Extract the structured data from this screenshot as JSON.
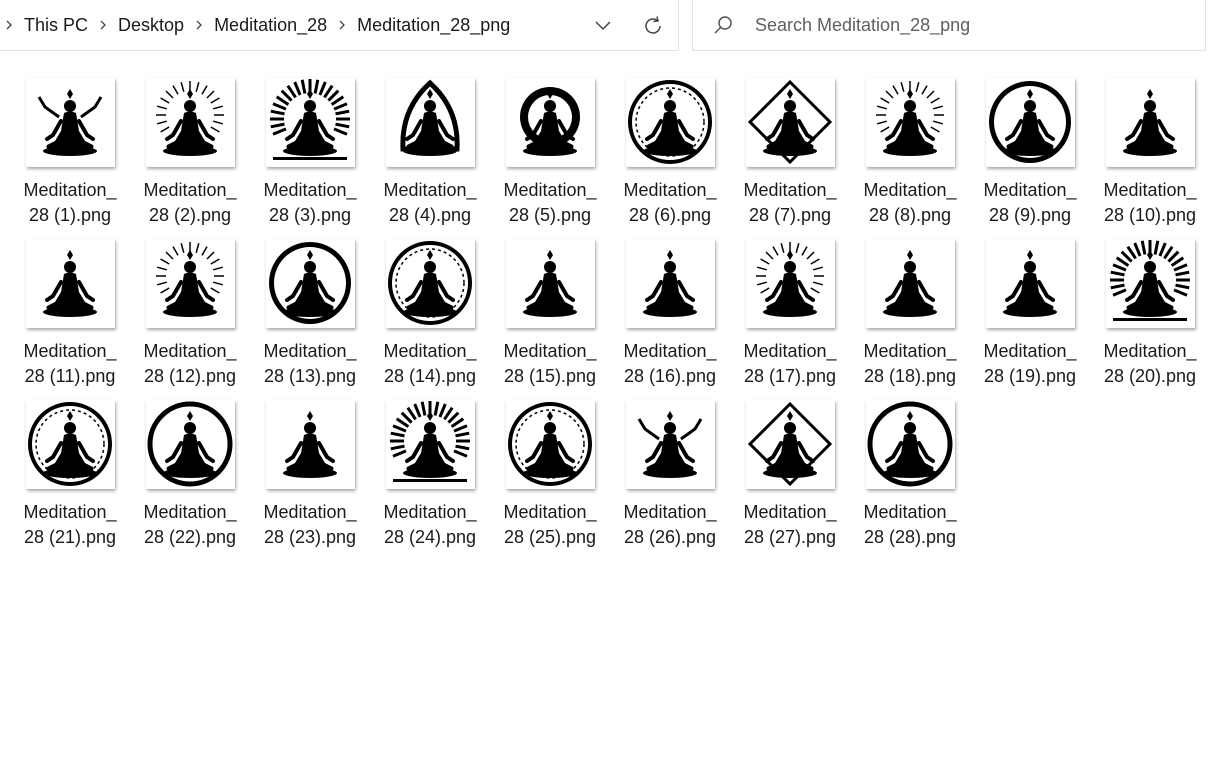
{
  "breadcrumb": [
    "This PC",
    "Desktop",
    "Meditation_28",
    "Meditation_28_png"
  ],
  "search": {
    "placeholder": "Search Meditation_28_png",
    "value": ""
  },
  "icons": {
    "breadcrumb_expand": "chevron-right-icon",
    "separator": "chevron-right-icon",
    "history": "chevron-down-icon",
    "refresh": "refresh-icon",
    "search": "search-icon"
  },
  "files": [
    {
      "line1": "Meditation_",
      "line2": "28 (1).png",
      "style": "arms"
    },
    {
      "line1": "Meditation_",
      "line2": "28 (2).png",
      "style": "rays"
    },
    {
      "line1": "Meditation_",
      "line2": "28 (3).png",
      "style": "sunburst"
    },
    {
      "line1": "Meditation_",
      "line2": "28 (4).png",
      "style": "arch"
    },
    {
      "line1": "Meditation_",
      "line2": "28 (5).png",
      "style": "halo"
    },
    {
      "line1": "Meditation_",
      "line2": "28 (6).png",
      "style": "mandala"
    },
    {
      "line1": "Meditation_",
      "line2": "28 (7).png",
      "style": "frame"
    },
    {
      "line1": "Meditation_",
      "line2": "28 (8).png",
      "style": "rays"
    },
    {
      "line1": "Meditation_",
      "line2": "28 (9).png",
      "style": "circle"
    },
    {
      "line1": "Meditation_",
      "line2": "28 (10).png",
      "style": "plain"
    },
    {
      "line1": "Meditation_",
      "line2": "28 (11).png",
      "style": "plain"
    },
    {
      "line1": "Meditation_",
      "line2": "28 (12).png",
      "style": "rays"
    },
    {
      "line1": "Meditation_",
      "line2": "28 (13).png",
      "style": "circle"
    },
    {
      "line1": "Meditation_",
      "line2": "28 (14).png",
      "style": "mandala"
    },
    {
      "line1": "Meditation_",
      "line2": "28 (15).png",
      "style": "plain"
    },
    {
      "line1": "Meditation_",
      "line2": "28 (16).png",
      "style": "plain"
    },
    {
      "line1": "Meditation_",
      "line2": "28 (17).png",
      "style": "rays"
    },
    {
      "line1": "Meditation_",
      "line2": "28 (18).png",
      "style": "plain"
    },
    {
      "line1": "Meditation_",
      "line2": "28 (19).png",
      "style": "plain"
    },
    {
      "line1": "Meditation_",
      "line2": "28 (20).png",
      "style": "sunburst"
    },
    {
      "line1": "Meditation_",
      "line2": "28 (21).png",
      "style": "mandala"
    },
    {
      "line1": "Meditation_",
      "line2": "28 (22).png",
      "style": "ring"
    },
    {
      "line1": "Meditation_",
      "line2": "28 (23).png",
      "style": "plain"
    },
    {
      "line1": "Meditation_",
      "line2": "28 (24).png",
      "style": "sunburst"
    },
    {
      "line1": "Meditation_",
      "line2": "28 (25).png",
      "style": "mandala"
    },
    {
      "line1": "Meditation_",
      "line2": "28 (26).png",
      "style": "arms"
    },
    {
      "line1": "Meditation_",
      "line2": "28 (27).png",
      "style": "frame"
    },
    {
      "line1": "Meditation_",
      "line2": "28 (28).png",
      "style": "ring"
    }
  ],
  "colors": {
    "ink": "#000000",
    "text": "#1a1a1a",
    "border": "#e2e2e2",
    "placeholder": "#5f5f5f"
  }
}
